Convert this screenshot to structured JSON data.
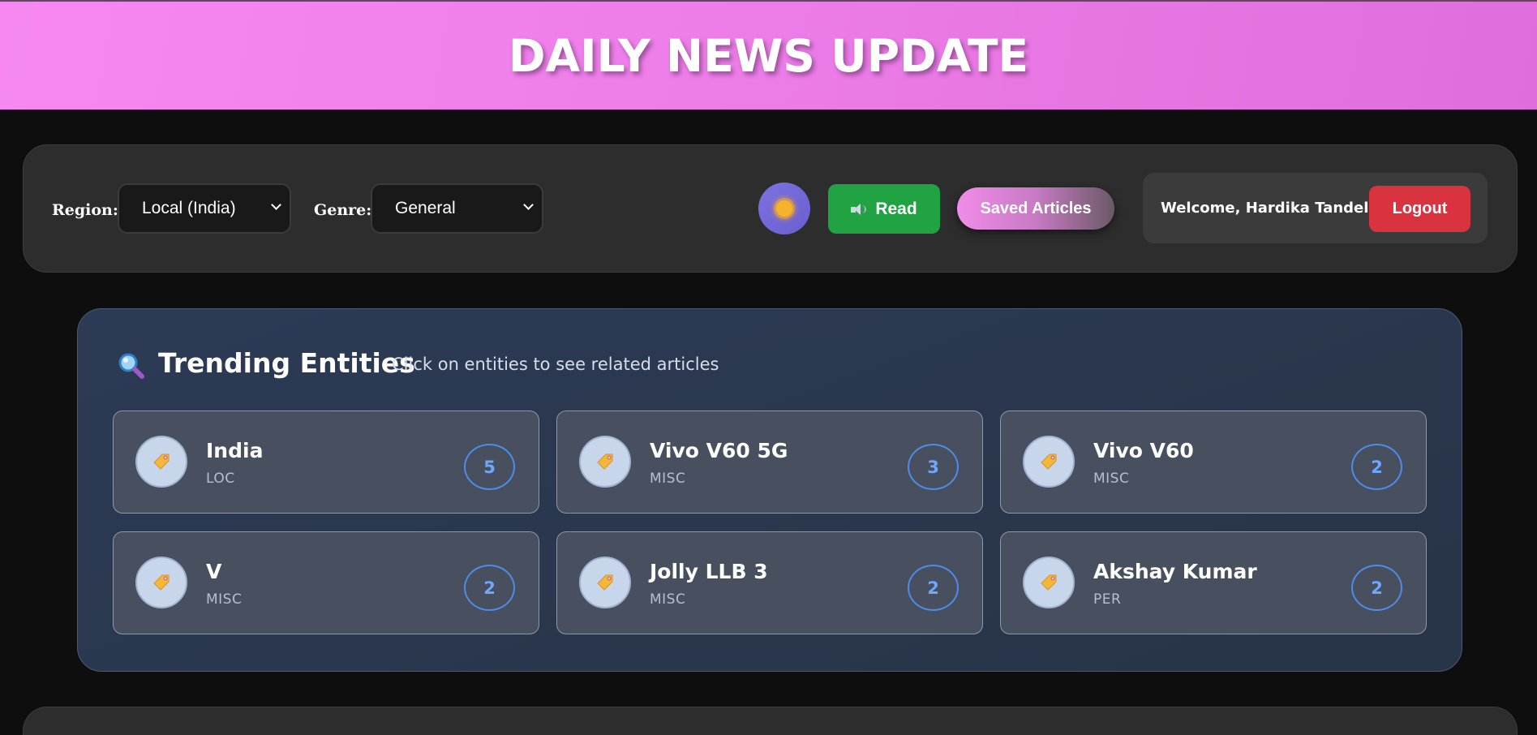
{
  "header": {
    "title": "DAILY NEWS UPDATE"
  },
  "toolbar": {
    "region_label": "Region:",
    "region_value": "Local (India)",
    "genre_label": "Genre:",
    "genre_value": "General",
    "theme_icon": "sun-icon",
    "read_label": "Read",
    "read_icon": "speaker-icon",
    "saved_label": "Saved Articles",
    "welcome": "Welcome, Hardika Tandel!",
    "logout_label": "Logout"
  },
  "trending": {
    "icon": "magnifier-icon",
    "title": "Trending Entities",
    "subtitle": "Click on entities to see related articles",
    "entities": [
      {
        "name": "India",
        "type": "LOC",
        "count": "5"
      },
      {
        "name": "Vivo V60 5G",
        "type": "MISC",
        "count": "3"
      },
      {
        "name": "Vivo V60",
        "type": "MISC",
        "count": "2"
      },
      {
        "name": "V",
        "type": "MISC",
        "count": "2"
      },
      {
        "name": "Jolly LLB 3",
        "type": "MISC",
        "count": "2"
      },
      {
        "name": "Akshay Kumar",
        "type": "PER",
        "count": "2"
      }
    ]
  },
  "colors": {
    "header_pink": "#f788f3",
    "read_green": "#21a344",
    "logout_red": "#d93340",
    "count_blue": "#4e8ce8"
  }
}
